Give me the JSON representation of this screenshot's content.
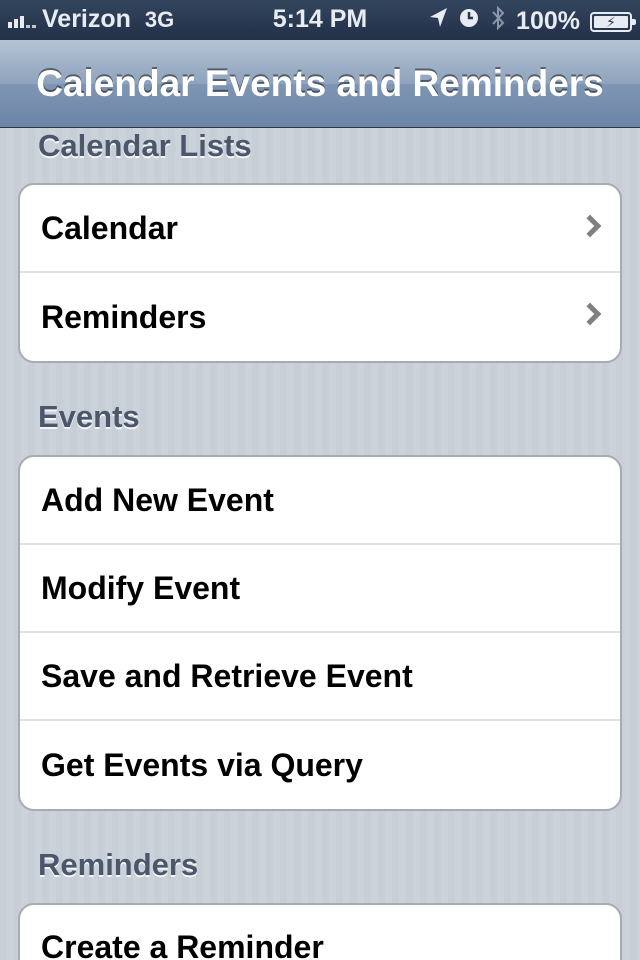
{
  "status_bar": {
    "carrier": "Verizon",
    "network": "3G",
    "time": "5:14 PM",
    "battery": "100%",
    "icons": [
      "signal-icon",
      "location-arrow-icon",
      "alarm-clock-icon",
      "bluetooth-icon",
      "battery-charging-icon"
    ]
  },
  "nav": {
    "title": "Calendar Events and Reminders"
  },
  "sections": [
    {
      "header": "Calendar Lists",
      "rows": [
        {
          "label": "Calendar",
          "disclosure": true
        },
        {
          "label": "Reminders",
          "disclosure": true
        }
      ]
    },
    {
      "header": "Events",
      "rows": [
        {
          "label": "Add New Event"
        },
        {
          "label": "Modify Event"
        },
        {
          "label": "Save and Retrieve Event"
        },
        {
          "label": "Get Events via Query"
        }
      ]
    },
    {
      "header": "Reminders",
      "rows": [
        {
          "label": "Create a Reminder"
        }
      ]
    }
  ],
  "colors": {
    "nav_gradient_top": "#b6c3d4",
    "nav_gradient_bottom": "#6d85a6",
    "background": "#c5ccd4",
    "section_header_text": "#4c566c",
    "status_bar": "#223048"
  }
}
